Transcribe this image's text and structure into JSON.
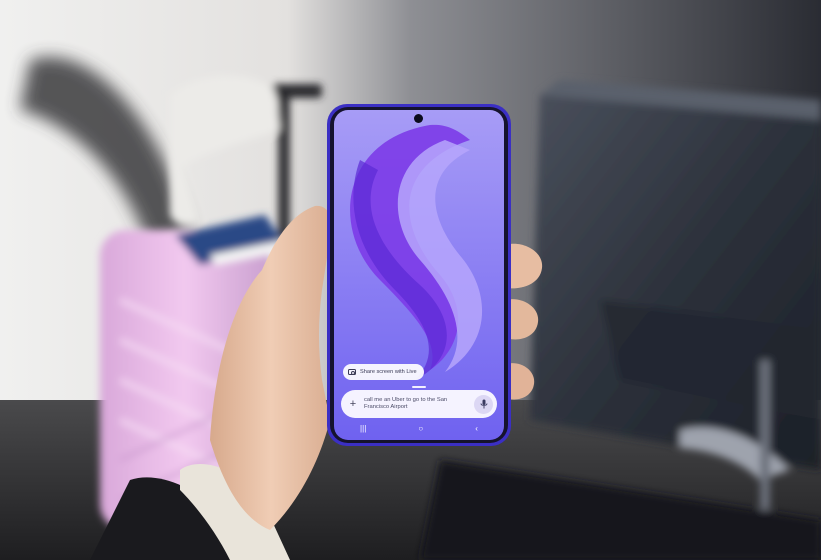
{
  "scene": {
    "description_icons": [
      "camera-icon",
      "plus-icon",
      "mic-icon",
      "recents-icon",
      "home-icon",
      "back-icon"
    ]
  },
  "phone": {
    "live_chip": "Share screen with Live",
    "prompt": "call me an Uber to go to the San Francisco Airport",
    "nav": {
      "recents": "|||",
      "home": "○",
      "back": "‹"
    }
  },
  "colors": {
    "screen_top": "#a79cf6",
    "screen_bottom": "#6f62f0",
    "ribbon": "#7c3be8",
    "phone_frame": "#3b2fc4",
    "suitcase": "#e7b8e8",
    "chair": "#2f3440"
  }
}
